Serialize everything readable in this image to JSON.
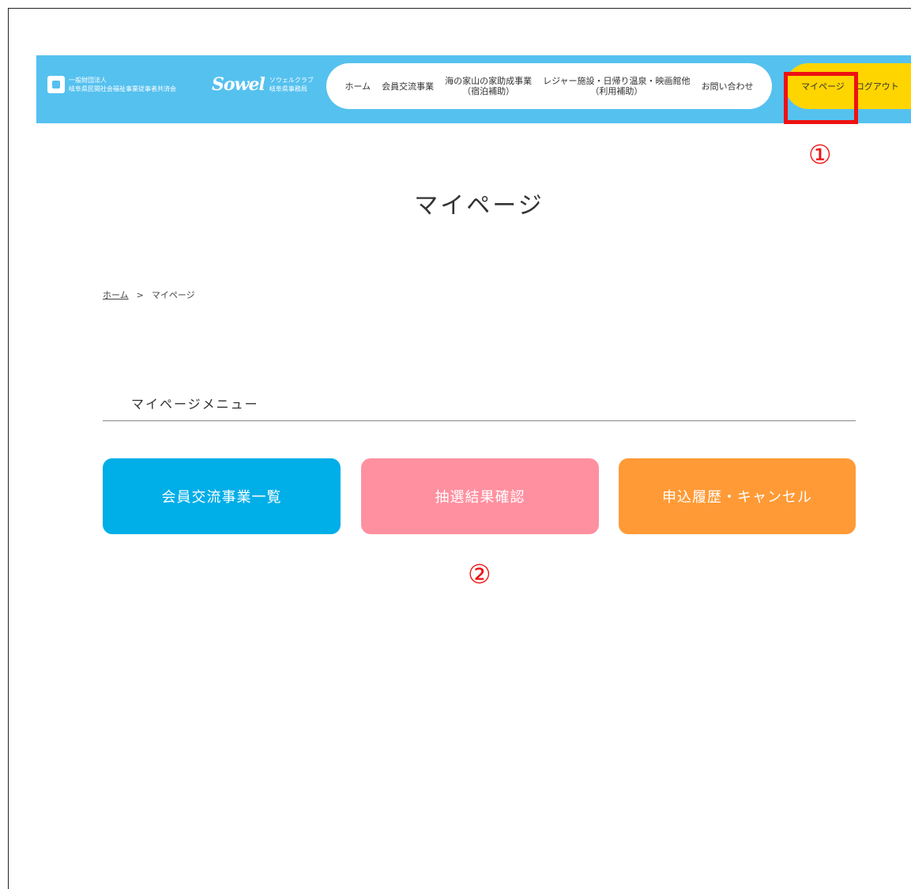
{
  "header": {
    "org_line1": "一般財団法人",
    "org_line2": "岐阜県民間社会福祉事業従事者共済会",
    "sowel_logo": "Sowel",
    "sowel_line1": "ソウェルクラブ",
    "sowel_line2": "岐阜県事務局",
    "background_color": "#55c1ef"
  },
  "nav": {
    "items": [
      {
        "label": "ホーム",
        "sub": ""
      },
      {
        "label": "会員交流事業",
        "sub": ""
      },
      {
        "label": "海の家山の家助成事業",
        "sub": "（宿泊補助）"
      },
      {
        "label": "レジャー施設・日帰り温泉・映画館他",
        "sub": "（利用補助）"
      },
      {
        "label": "お問い合わせ",
        "sub": ""
      }
    ],
    "mypage": "マイページ",
    "logout": "ログアウト",
    "accent_color": "#ffd500"
  },
  "annotations": {
    "marker1": "①",
    "marker2": "②",
    "color": "#ee1111"
  },
  "page": {
    "title": "マイページ"
  },
  "breadcrumb": {
    "home": "ホーム",
    "separator": ">",
    "current": "マイページ"
  },
  "menu": {
    "heading": "マイページメニュー",
    "buttons": [
      {
        "label": "会員交流事業一覧",
        "color": "#00aee8"
      },
      {
        "label": "抽選結果確認",
        "color": "#ff90a0"
      },
      {
        "label": "申込履歴・キャンセル",
        "color": "#ff9a36"
      }
    ]
  }
}
